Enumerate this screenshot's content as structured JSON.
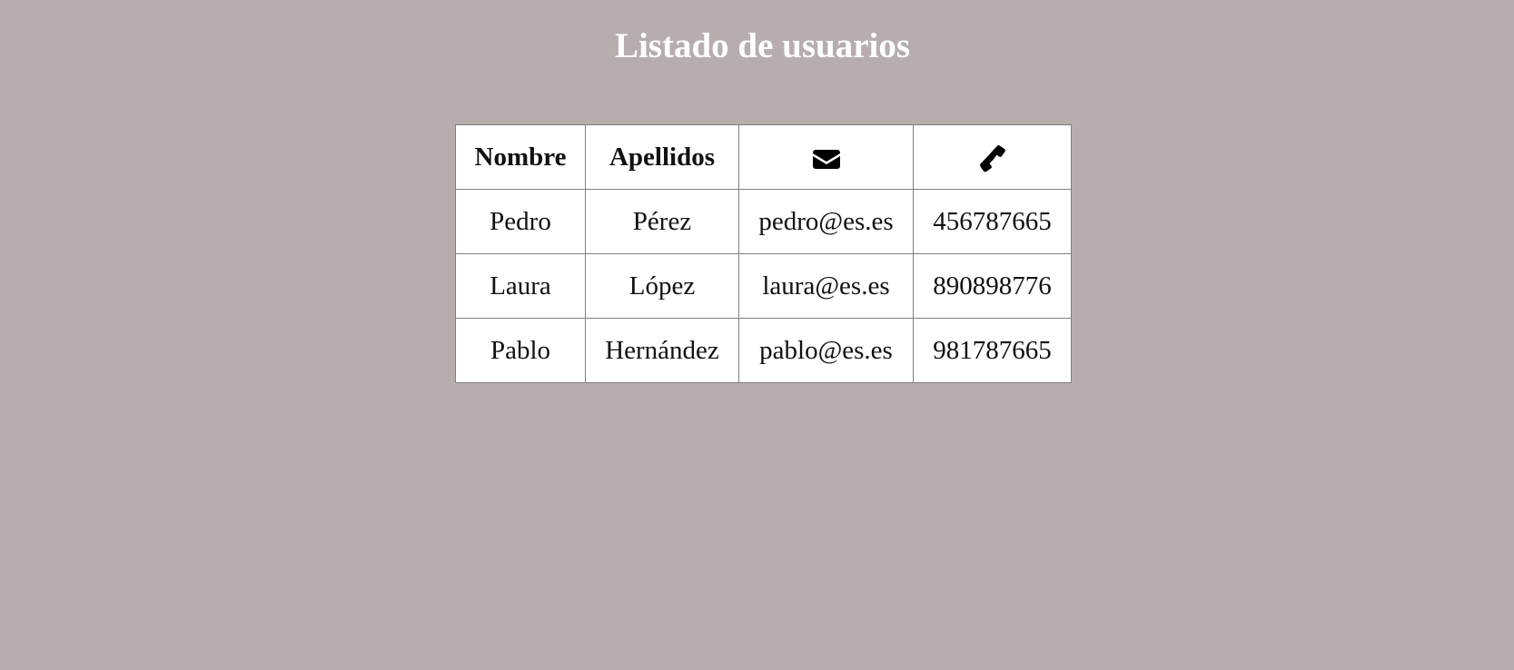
{
  "page": {
    "title": "Listado de usuarios"
  },
  "table": {
    "headers": {
      "nombre": "Nombre",
      "apellidos": "Apellidos",
      "email_icon": "envelope-icon",
      "phone_icon": "phone-icon"
    },
    "rows": [
      {
        "nombre": "Pedro",
        "apellidos": "Pérez",
        "email": "pedro@es.es",
        "telefono": "456787665"
      },
      {
        "nombre": "Laura",
        "apellidos": "López",
        "email": "laura@es.es",
        "telefono": "890898776"
      },
      {
        "nombre": "Pablo",
        "apellidos": "Hernández",
        "email": "pablo@es.es",
        "telefono": "981787665"
      }
    ]
  },
  "colors": {
    "background": "#b7adac",
    "title": "#ffffff",
    "table_background": "#ffffff"
  }
}
